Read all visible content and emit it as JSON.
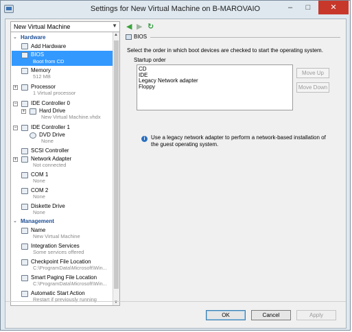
{
  "window": {
    "title": "Settings for New Virtual Machine on B-MAROVAIO",
    "minimize": "–",
    "maximize": "□",
    "close": "✕"
  },
  "vm_selector": {
    "value": "New Virtual Machine"
  },
  "nav": {
    "back": "◀",
    "forward": "▶",
    "refresh": "↻"
  },
  "tree": {
    "hardware_label": "Hardware",
    "management_label": "Management",
    "hardware": [
      {
        "label": "Add Hardware",
        "sub": ""
      },
      {
        "label": "BIOS",
        "sub": "Boot from CD"
      },
      {
        "label": "Memory",
        "sub": "512 MB"
      },
      {
        "label": "Processor",
        "sub": "1 Virtual processor"
      },
      {
        "label": "IDE Controller 0",
        "sub": ""
      },
      {
        "label": "Hard Drive",
        "sub": "New Virtual Machine.vhdx"
      },
      {
        "label": "IDE Controller 1",
        "sub": ""
      },
      {
        "label": "DVD Drive",
        "sub": "None"
      },
      {
        "label": "SCSI Controller",
        "sub": ""
      },
      {
        "label": "Network Adapter",
        "sub": "Not connected"
      },
      {
        "label": "COM 1",
        "sub": "None"
      },
      {
        "label": "COM 2",
        "sub": "None"
      },
      {
        "label": "Diskette Drive",
        "sub": "None"
      }
    ],
    "management": [
      {
        "label": "Name",
        "sub": "New Virtual Machine"
      },
      {
        "label": "Integration Services",
        "sub": "Some services offered"
      },
      {
        "label": "Checkpoint File Location",
        "sub": "C:\\ProgramData\\Microsoft\\Win..."
      },
      {
        "label": "Smart Paging File Location",
        "sub": "C:\\ProgramData\\Microsoft\\Win..."
      },
      {
        "label": "Automatic Start Action",
        "sub": "Restart if previously running"
      }
    ]
  },
  "bios": {
    "header": "BIOS",
    "description": "Select the order in which boot devices are checked to start the operating system.",
    "startup_label": "Startup order",
    "startup_order": [
      "CD",
      "IDE",
      "Legacy Network adapter",
      "Floppy"
    ],
    "move_up": "Move Up",
    "move_down": "Move Down",
    "info": "Use a legacy network adapter to perform a network-based installation of the guest operating system."
  },
  "buttons": {
    "ok": "OK",
    "cancel": "Cancel",
    "apply": "Apply"
  },
  "colors": {
    "selection": "#3399ff",
    "section_header": "#1d4e94",
    "close_button": "#c7382b"
  }
}
